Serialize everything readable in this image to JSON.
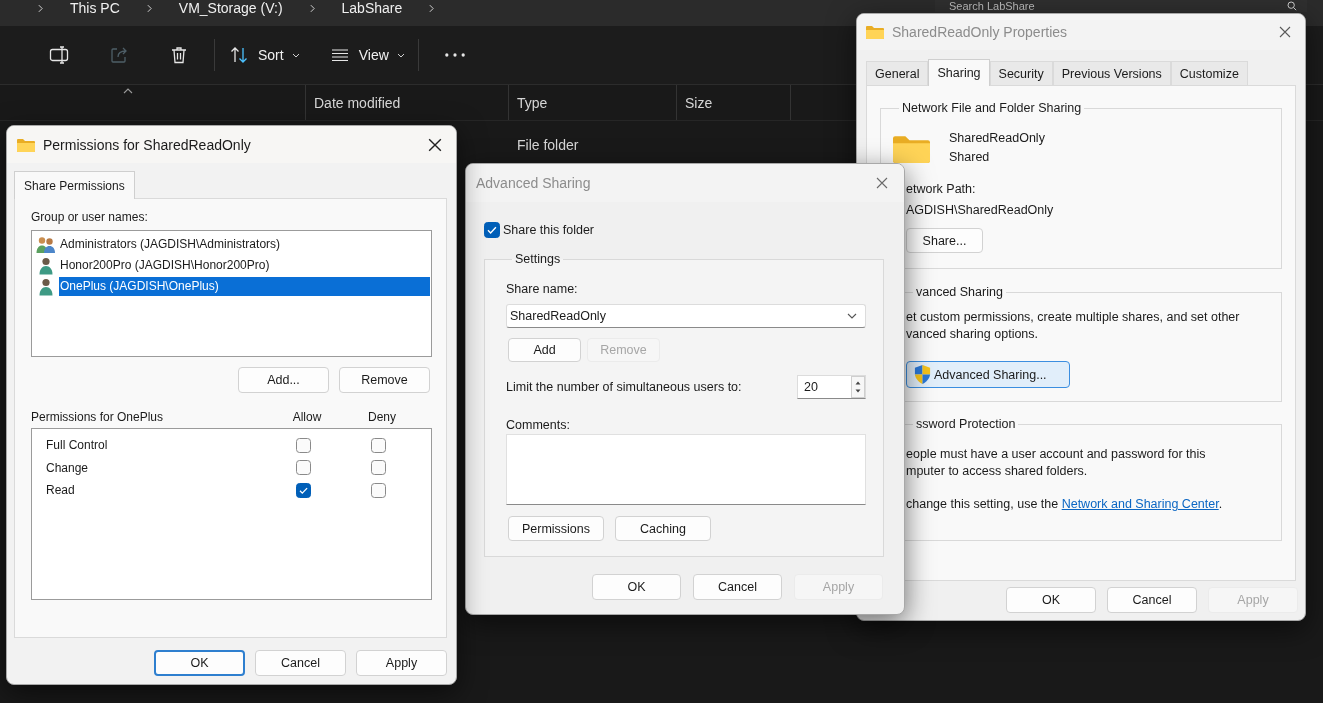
{
  "explorer": {
    "breadcrumb": [
      "This PC",
      "VM_Storage (V:)",
      "LabShare"
    ],
    "search": {
      "placeholder": "Search LabShare"
    },
    "toolbar": {
      "rename": {
        "disabled": false
      },
      "share": {
        "disabled": true
      },
      "delete": {
        "disabled": false
      },
      "sort": {
        "label": "Sort"
      },
      "view": {
        "label": "View"
      }
    },
    "columns": [
      "Date modified",
      "Type",
      "Size"
    ],
    "rows": [
      {
        "type": "File folder"
      }
    ]
  },
  "permissions_dialog": {
    "title": "Permissions for SharedReadOnly",
    "active": true,
    "tabs": [
      {
        "label": "Share Permissions",
        "selected": true
      }
    ],
    "users_label": "Group or user names:",
    "users": [
      {
        "name": "Administrators (JAGDISH\\Administrators)",
        "kind": "group",
        "selected": false
      },
      {
        "name": "Honor200Pro (JAGDISH\\Honor200Pro)",
        "kind": "user",
        "selected": false
      },
      {
        "name": "OnePlus (JAGDISH\\OnePlus)",
        "kind": "user",
        "selected": true
      }
    ],
    "user_buttons": [
      "Add...",
      "Remove"
    ],
    "permissions_label": "Permissions for OnePlus",
    "permission_columns": [
      "Allow",
      "Deny"
    ],
    "permissions": [
      {
        "name": "Full Control",
        "allow": false,
        "deny": false
      },
      {
        "name": "Change",
        "allow": false,
        "deny": false
      },
      {
        "name": "Read",
        "allow": true,
        "deny": false
      }
    ],
    "buttons": [
      {
        "label": "OK",
        "default": true,
        "disabled": false
      },
      {
        "label": "Cancel",
        "default": false,
        "disabled": false
      },
      {
        "label": "Apply",
        "default": false,
        "disabled": false
      }
    ]
  },
  "advanced_sharing_dialog": {
    "title": "Advanced Sharing",
    "active": false,
    "share_folder": {
      "label": "Share this folder",
      "checked": true
    },
    "settings": {
      "title": "Settings",
      "share_name_label": "Share name:",
      "share_name": "SharedReadOnly",
      "name_buttons": [
        {
          "label": "Add",
          "disabled": false
        },
        {
          "label": "Remove",
          "disabled": true
        }
      ],
      "limit_label": "Limit the number of simultaneous users to:",
      "limit_value": "20",
      "comments_label": "Comments:",
      "buttons": [
        {
          "label": "Permissions",
          "disabled": false
        },
        {
          "label": "Caching",
          "disabled": false
        }
      ]
    },
    "buttons": [
      {
        "label": "OK",
        "disabled": false
      },
      {
        "label": "Cancel",
        "disabled": false
      },
      {
        "label": "Apply",
        "disabled": true
      }
    ]
  },
  "properties_dialog": {
    "title": "SharedReadOnly Properties",
    "active": false,
    "tabs": [
      {
        "label": "General",
        "selected": false
      },
      {
        "label": "Sharing",
        "selected": true
      },
      {
        "label": "Security",
        "selected": false
      },
      {
        "label": "Previous Versions",
        "selected": false
      },
      {
        "label": "Customize",
        "selected": false
      }
    ],
    "network_sharing": {
      "title": "Network File and Folder Sharing",
      "folder_name": "SharedReadOnly",
      "status": "Shared",
      "path_label": "etwork Path:",
      "path": "AGDISH\\SharedReadOnly",
      "share_button": "Share..."
    },
    "advanced_sharing": {
      "title": "vanced Sharing",
      "description_lines": [
        "et custom permissions, create multiple shares, and set other",
        "vanced sharing options."
      ],
      "button": {
        "label": "Advanced Sharing...",
        "focused": true
      }
    },
    "password_protection": {
      "title": "ssword Protection",
      "description_lines": [
        "eople must have a user account and password for this",
        "mputer to access shared folders."
      ],
      "note": {
        "text": "change this setting, use the",
        "link": "Network and Sharing Center",
        "after": "."
      }
    },
    "buttons": [
      {
        "label": "OK",
        "disabled": false
      },
      {
        "label": "Cancel",
        "disabled": false
      },
      {
        "label": "Apply",
        "disabled": true
      }
    ]
  }
}
